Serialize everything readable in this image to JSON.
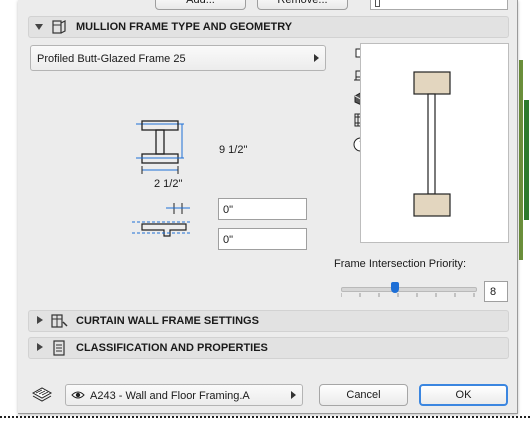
{
  "top_buttons": {
    "add": "Add...",
    "remove": "Remove..."
  },
  "geometry_section": {
    "title": "MULLION FRAME TYPE AND GEOMETRY",
    "expanded": true
  },
  "frame_type": {
    "selected": "Profiled Butt-Glazed Frame 25"
  },
  "dimensions": {
    "depth": "9 1/2\"",
    "width": "2 1/2\"",
    "offset_1": "0\"",
    "offset_2": "0\""
  },
  "priority": {
    "label": "Frame Intersection Priority:",
    "value": "8",
    "slider_fraction": 0.4
  },
  "sections": [
    {
      "title": "CURTAIN WALL FRAME SETTINGS",
      "expanded": false
    },
    {
      "title": "CLASSIFICATION AND PROPERTIES",
      "expanded": false
    }
  ],
  "layer": {
    "selected": "A243 - Wall and Floor Framing.A"
  },
  "actions": {
    "cancel": "Cancel",
    "ok": "OK"
  },
  "colors": {
    "accent": "#1e6fd6",
    "profile_fill": "#e3d6bf"
  },
  "view_icons": [
    "plan-view-icon",
    "cross-section-view-icon",
    "3d-view-icon",
    "frame-view-icon",
    "info-icon"
  ]
}
